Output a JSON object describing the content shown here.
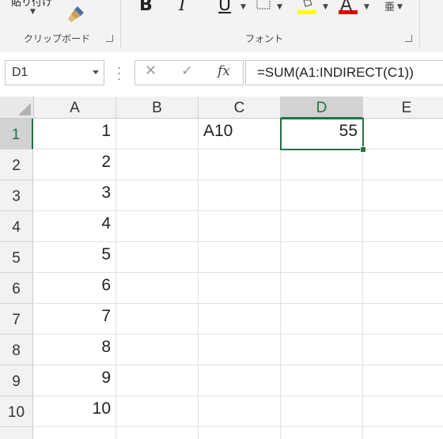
{
  "ribbon": {
    "clipboard_clipped": "貼り付け",
    "clipboard_group": "クリップボード",
    "font_group": "フォント",
    "bold": "B",
    "italic": "I",
    "underline": "U",
    "font_color": "A",
    "highlight_color": "#ffff00",
    "font_color_bar": "#e00000",
    "phonetic": "亜"
  },
  "formula_bar": {
    "name_box": "D1",
    "cancel": "✕",
    "enter": "✓",
    "fx": "fx",
    "formula": "=SUM(A1:INDIRECT(C1))"
  },
  "sheet": {
    "columns": [
      "A",
      "B",
      "C",
      "D",
      "E"
    ],
    "rows": [
      "1",
      "2",
      "3",
      "4",
      "5",
      "6",
      "7",
      "8",
      "9",
      "10"
    ],
    "active_cell": "D1",
    "cells": {
      "A1": "1",
      "A2": "2",
      "A3": "3",
      "A4": "4",
      "A5": "5",
      "A6": "6",
      "A7": "7",
      "A8": "8",
      "A9": "9",
      "A10": "10",
      "C1": "A10",
      "D1": "55"
    },
    "accent": "#217346"
  }
}
